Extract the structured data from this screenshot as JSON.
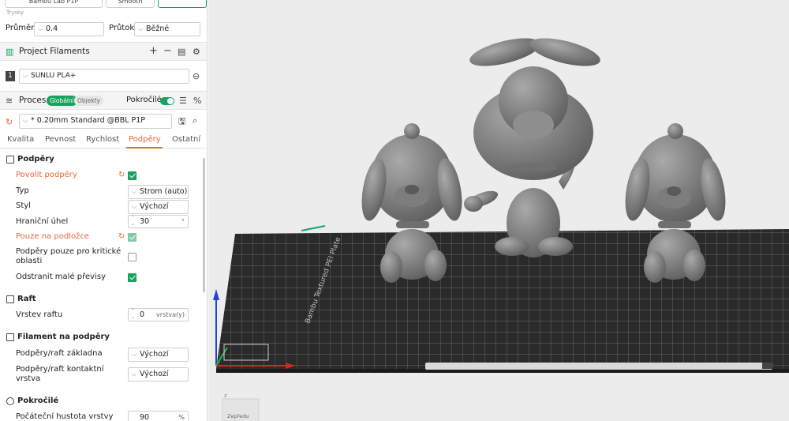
{
  "top_buttons": [
    "Bambu Lab P1P",
    "Smooth",
    ""
  ],
  "nozzle": {
    "section_label": "Trysky",
    "diameter_label": "Průměr",
    "diameter_value": "0.4",
    "flow_label": "Průtok",
    "flow_value": "Běžné"
  },
  "filaments": {
    "title": "Project Filaments",
    "slot_number": "1",
    "filament": "SUNLU PLA+"
  },
  "process": {
    "title": "Proces",
    "global_label": "Globální",
    "objects_label": "Objekty",
    "advanced_label": "Pokročilé",
    "advanced_on": true,
    "preset": "* 0.20mm Standard @BBL P1P"
  },
  "tabs": [
    "Kvalita",
    "Pevnost",
    "Rychlost",
    "Podpěry",
    "Ostatní"
  ],
  "active_tab": "Podpěry",
  "supports": {
    "title": "Podpěry",
    "enable_label": "Povolit podpěry",
    "enable_checked": true,
    "type_label": "Typ",
    "type_value": "Strom (auto)",
    "style_label": "Styl",
    "style_value": "Výchozí",
    "threshold_label": "Hraniční úhel",
    "threshold_value": "30",
    "threshold_unit": "°",
    "on_plate_label": "Pouze na podložce",
    "on_plate_checked": true,
    "critical_label_line1": "Podpěry pouze pro kritické",
    "critical_label_line2": "oblasti",
    "critical_checked": false,
    "remove_small_label": "Odstranit malé převisy",
    "remove_small_checked": true
  },
  "raft": {
    "title": "Raft",
    "layers_label": "Vrstev raftu",
    "layers_value": "0",
    "layers_unit": "vrstva(y)"
  },
  "support_filament": {
    "title": "Filament na podpěry",
    "base_label": "Podpěry/raft základna",
    "base_value": "Výchozí",
    "interface_label_line1": "Podpěry/raft kontaktní",
    "interface_label_line2": "vrstva",
    "interface_value": "Výchozí"
  },
  "advanced": {
    "title": "Pokročilé",
    "initial_density_label": "Počáteční hustota vrstvy",
    "initial_density_value": "90",
    "initial_density_unit": "%"
  },
  "viewport": {
    "axis_z": "z",
    "view_cube_label": "Zepředu",
    "plate_text": "Bambu Textured PEI Plate",
    "bg_color": "#ececec",
    "plate_color": "#2b2b2b",
    "model_color": "#8a8a8a"
  }
}
